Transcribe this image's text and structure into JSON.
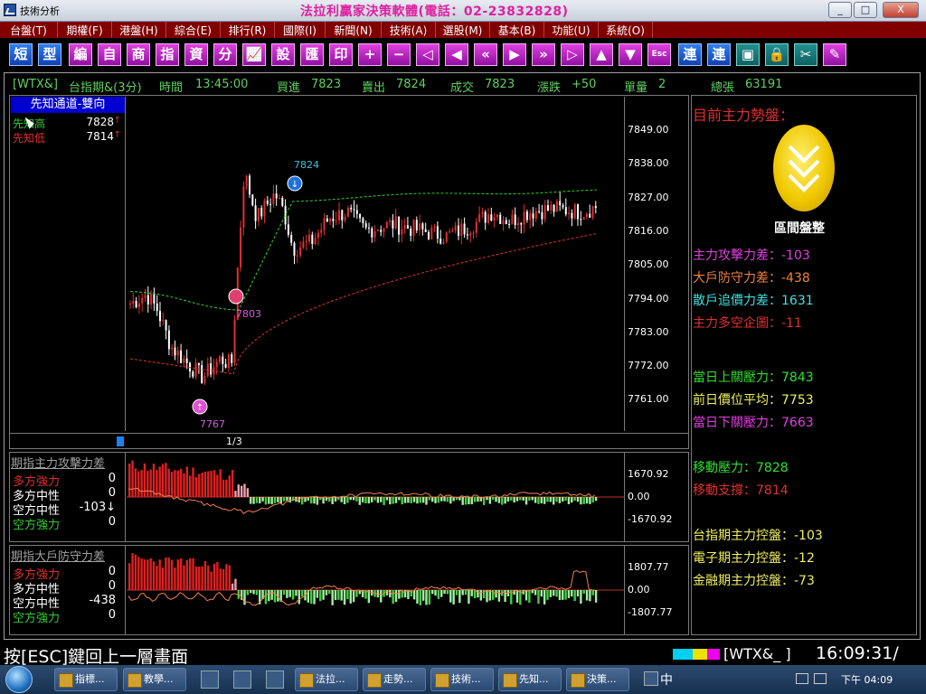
{
  "window": {
    "title": "技術分析",
    "brand": "法拉利贏家決策軟體(電話：02-23832828)",
    "controls": [
      "_",
      "□",
      "X"
    ]
  },
  "menu": [
    {
      "label": "台盤(T)",
      "width": 64
    },
    {
      "label": "期權(F)",
      "width": 60
    },
    {
      "label": "港盤(H)",
      "width": 60
    },
    {
      "label": "綜合(E)",
      "width": 60
    },
    {
      "label": "排行(R)",
      "width": 60
    },
    {
      "label": "國際(I)",
      "width": 56
    },
    {
      "label": "新聞(N)",
      "width": 62
    },
    {
      "label": "技術(A)",
      "width": 60
    },
    {
      "label": "選股(M)",
      "width": 60
    },
    {
      "label": "基本(B)",
      "width": 60
    },
    {
      "label": "功能(U)",
      "width": 60
    },
    {
      "label": "系統(O)",
      "width": 60
    }
  ],
  "toolbar": {
    "buttons": [
      {
        "label": "短",
        "name": "short-button",
        "style": "blue"
      },
      {
        "label": "型",
        "name": "pattern-button",
        "style": "blue"
      },
      {
        "label": "編",
        "name": "edit-button",
        "style": "magenta"
      },
      {
        "label": "自",
        "name": "self-button",
        "style": "magenta"
      },
      {
        "label": "商",
        "name": "product-button",
        "style": "magenta"
      },
      {
        "label": "指",
        "name": "index-button",
        "style": "magenta"
      },
      {
        "label": "資",
        "name": "data-button",
        "style": "magenta"
      },
      {
        "label": "分",
        "name": "minute-button",
        "style": "magenta"
      },
      {
        "label": "📈",
        "name": "chart-icon",
        "style": "magenta"
      },
      {
        "label": "設",
        "name": "settings-button",
        "style": "magenta"
      },
      {
        "label": "匯",
        "name": "export-button",
        "style": "magenta"
      },
      {
        "label": "印",
        "name": "print-button",
        "style": "magenta"
      },
      {
        "label": "+",
        "name": "zoom-in-button",
        "style": "magenta"
      },
      {
        "label": "−",
        "name": "zoom-out-button",
        "style": "magenta"
      },
      {
        "label": "◁",
        "name": "first-icon",
        "style": "magenta"
      },
      {
        "label": "◀",
        "name": "prev-icon",
        "style": "magenta"
      },
      {
        "label": "«",
        "name": "rewind-icon",
        "style": "magenta"
      },
      {
        "label": "▶",
        "name": "next-icon",
        "style": "magenta"
      },
      {
        "label": "»",
        "name": "forward-icon",
        "style": "magenta"
      },
      {
        "label": "▷",
        "name": "last-icon",
        "style": "magenta"
      },
      {
        "label": "▲",
        "name": "up-icon",
        "style": "magenta"
      },
      {
        "label": "▼",
        "name": "down-icon",
        "style": "magenta"
      },
      {
        "label": "Esc",
        "name": "esc-button",
        "style": "magenta"
      },
      {
        "label": "連",
        "name": "link-button",
        "style": "blue"
      },
      {
        "label": "連",
        "name": "link2-button",
        "style": "blue"
      },
      {
        "label": "▣",
        "name": "window-icon",
        "style": "teal"
      },
      {
        "label": "🔒",
        "name": "lock-icon",
        "style": "teal"
      },
      {
        "label": "✂",
        "name": "tools-icon",
        "style": "teal"
      },
      {
        "label": "✎",
        "name": "pen-icon",
        "style": "magenta"
      }
    ]
  },
  "info_bar": {
    "symbol": "[WTX&]",
    "name": "台指期&(3分)",
    "time_label": "時間",
    "time": "13:45:00",
    "bid_label": "買進",
    "bid": "7823",
    "ask_label": "賣出",
    "ask": "7824",
    "deal_label": "成交",
    "deal": "7823",
    "change_label": "漲跌",
    "change": "+50",
    "volume_label": "單量",
    "volume": "2",
    "total_label": "總張",
    "total": "63191"
  },
  "left_panel": {
    "mode": "先知通道-雙向",
    "rows": [
      {
        "label": "先知高",
        "value": "7828",
        "color": "#30d030"
      },
      {
        "label": "先知低",
        "value": "7814",
        "color": "#e03030"
      }
    ],
    "page": "1/3"
  },
  "price_axis": [
    "7849.00",
    "7838.00",
    "7827.00",
    "7816.00",
    "7805.00",
    "7794.00",
    "7783.00",
    "7772.00",
    "7761.00"
  ],
  "annotations": {
    "high_mark": "7824",
    "mid_mark": "7803",
    "low_mark": "7767"
  },
  "indicator1": {
    "title": "期指主力攻擊力差",
    "rows": [
      {
        "label": "多方強力",
        "value": "0",
        "color": "#e03030"
      },
      {
        "label": "多方中性",
        "value": "0",
        "color": "#ffffff"
      },
      {
        "label": "空方中性",
        "value": "-103↓",
        "color": "#ffffff"
      },
      {
        "label": "空方強力",
        "value": "0",
        "color": "#30d030"
      }
    ],
    "axis": [
      "1670.92",
      "0.00",
      "-1670.92"
    ]
  },
  "indicator2": {
    "title": "期指大戶防守力差",
    "rows": [
      {
        "label": "多方強力",
        "value": "0",
        "color": "#e03030"
      },
      {
        "label": "多方中性",
        "value": "0",
        "color": "#ffffff"
      },
      {
        "label": "空方中性",
        "value": "-438",
        "color": "#ffffff"
      },
      {
        "label": "空方強力",
        "value": "0",
        "color": "#30d030"
      }
    ],
    "axis": [
      "1807.77",
      "0.00",
      "-1807.77"
    ]
  },
  "right_panel": {
    "heading": "目前主力勢盤：",
    "badge": "區間盤整",
    "lines": [
      {
        "label": "主力攻擊力差",
        "value": "-103",
        "color": "#e040e0"
      },
      {
        "label": "大戶防守力差",
        "value": "-438",
        "color": "#f08040"
      },
      {
        "label": "散戶追價力差",
        "value": "1631",
        "color": "#40e0e0"
      },
      {
        "label": "主力多空企圖",
        "value": "-11",
        "color": "#e03030"
      },
      {
        "label": "當日上關壓力",
        "value": "7843",
        "color": "#30e030"
      },
      {
        "label": "前日價位平均",
        "value": "7753",
        "color": "#f0f060"
      },
      {
        "label": "當日下關壓力",
        "value": "7663",
        "color": "#e040e0"
      },
      {
        "label": "移動壓力",
        "value": "7828",
        "color": "#30e030"
      },
      {
        "label": "移動支撐",
        "value": "7814",
        "color": "#e03030"
      },
      {
        "label": "台指期主力控盤",
        "value": "-103",
        "color": "#f0f060"
      },
      {
        "label": "電子期主力控盤",
        "value": "-12",
        "color": "#f0f060"
      },
      {
        "label": "金融期主力控盤",
        "value": "-73",
        "color": "#f0f060"
      }
    ]
  },
  "status": {
    "message": "按[ESC]鍵回上一層畫面",
    "symbol": "[WTX&_  ]",
    "clock": "16:09:31/"
  },
  "taskbar": {
    "tasks": [
      "指標...",
      "教學...",
      "法拉...",
      "走勢...",
      "技術...",
      "先知...",
      "決策..."
    ],
    "tray_lang": "中",
    "tray_time": "下午 04:09"
  }
}
